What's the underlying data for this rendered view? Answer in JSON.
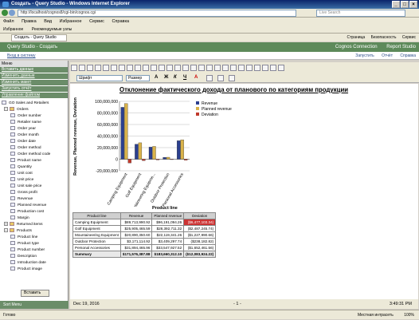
{
  "window": {
    "title": "Создать - Query Studio - Windows Internet Explorer"
  },
  "address": {
    "url": "http://localhost/cognos8/cgi-bin/cognos.cgi",
    "search_placeholder": "Live Search"
  },
  "menubar": [
    "Файл",
    "Правка",
    "Вид",
    "Избранное",
    "Сервис",
    "Справка"
  ],
  "favbar": {
    "favorites": "Избранное",
    "suggested": "Рекомендуемые узлы",
    "right": "Создать - Query Studio"
  },
  "tab": {
    "label": "Создать - Query Studio",
    "tools": [
      "Страница",
      "Безопасность",
      "Сервис"
    ]
  },
  "qs": {
    "title": "Query Studio - Создать",
    "links": [
      "Cognos Connection",
      "Report Studio"
    ]
  },
  "sub": {
    "left": "Вход в систему",
    "right": [
      "Запустить",
      "Отчёт",
      "Справка"
    ]
  },
  "left": {
    "menu_label": "Меню",
    "links": [
      "Вставить данные",
      "Изменить данные",
      "Изменить макет",
      "Запустить отчёт",
      "Управление файлом"
    ],
    "package": "GO Sales and Retailers",
    "tree": [
      {
        "label": "Orders",
        "type": "folder",
        "open": true
      },
      {
        "label": "Order number",
        "type": "item"
      },
      {
        "label": "Retailer name",
        "type": "item"
      },
      {
        "label": "Order year",
        "type": "item"
      },
      {
        "label": "Order month",
        "type": "item"
      },
      {
        "label": "Order date",
        "type": "item"
      },
      {
        "label": "Order method",
        "type": "item"
      },
      {
        "label": "Order method code",
        "type": "item"
      },
      {
        "label": "Product name",
        "type": "item"
      },
      {
        "label": "Quantity",
        "type": "item"
      },
      {
        "label": "Unit cost",
        "type": "item"
      },
      {
        "label": "Unit price",
        "type": "item"
      },
      {
        "label": "Unit sale price",
        "type": "item"
      },
      {
        "label": "Gross profit",
        "type": "item"
      },
      {
        "label": "Revenue",
        "type": "item"
      },
      {
        "label": "Planned revenue",
        "type": "item"
      },
      {
        "label": "Production cost",
        "type": "item"
      },
      {
        "label": "Margin",
        "type": "item"
      },
      {
        "label": "Returned items",
        "type": "folder",
        "open": false
      },
      {
        "label": "Products",
        "type": "folder",
        "open": true
      },
      {
        "label": "Product line",
        "type": "item"
      },
      {
        "label": "Product type",
        "type": "item"
      },
      {
        "label": "Product number",
        "type": "item"
      },
      {
        "label": "Description",
        "type": "item"
      },
      {
        "label": "Introduction date",
        "type": "item"
      },
      {
        "label": "Product image",
        "type": "item"
      }
    ],
    "insert_button": "Вставить",
    "bottom": "Sort Menu"
  },
  "toolbar": {
    "font": "Шрифт",
    "size": "Размер"
  },
  "content": {
    "title": "Отклонение фактического дохода от планового по категориям продукции",
    "product_line_label": "Product line",
    "table": {
      "headers": [
        "Product line",
        "Revenue",
        "Planned revenue",
        "Deviation"
      ],
      "rows": [
        [
          "Camping Equipment",
          "$89,713,990.92",
          "$96,191,094.26",
          "($6,477,103.34)"
        ],
        [
          "Golf Equipment",
          "$25,905,465.59",
          "$28,392,711.32",
          "($2,487,245.74)"
        ],
        [
          "Mountaineering Equipment",
          "$20,890,350.60",
          "$22,119,341.26",
          "($1,227,990.66)"
        ],
        [
          "Outdoor Protection",
          "$3,171,114.92",
          "$3,409,297.74",
          "($238,182.82)"
        ],
        [
          "Personal Accessories",
          "$31,894,465.96",
          "$33,547,927.52",
          "($1,652,461.56)"
        ]
      ],
      "summary": [
        "Summary",
        "$171,576,387.88",
        "$183,660,312.10",
        "($12,083,924.22)"
      ]
    }
  },
  "chart_data": {
    "type": "bar",
    "title": "Отклонение фактического дохода от планового по категориям продукции",
    "ylabel": "Revenue, Planned revenue, Deviation",
    "xlabel": "",
    "categories": [
      "Camping Equipment",
      "Golf Equipment",
      "Mountaineering Equipme...",
      "Outdoor Protection",
      "Personal Accessories"
    ],
    "ylim": [
      -20000000,
      100000000
    ],
    "yticks": [
      "100,000,000",
      "80,000,000",
      "60,000,000",
      "40,000,000",
      "20,000,000",
      "0",
      "-20,000,000"
    ],
    "series": [
      {
        "name": "Revenue",
        "color": "#2b3f8f",
        "values": [
          89713990.92,
          25905465.59,
          20890350.6,
          3171114.92,
          31894465.96
        ]
      },
      {
        "name": "Planned revenue",
        "color": "#d9b24a",
        "values": [
          96191094.26,
          28392711.32,
          22119341.26,
          3409297.74,
          33547927.52
        ]
      },
      {
        "name": "Deviation",
        "color": "#c0392b",
        "values": [
          -6477103.34,
          -2487245.74,
          -1227990.66,
          -238182.82,
          -1652461.56
        ]
      }
    ],
    "legend": "right",
    "grid": true
  },
  "footer": {
    "date": "Dec 19, 2016",
    "page": "- 1 -",
    "time": "3:49:31 PM"
  },
  "status": {
    "left": "Готово",
    "zone": "Местная интрасеть",
    "zoom": "100%"
  }
}
